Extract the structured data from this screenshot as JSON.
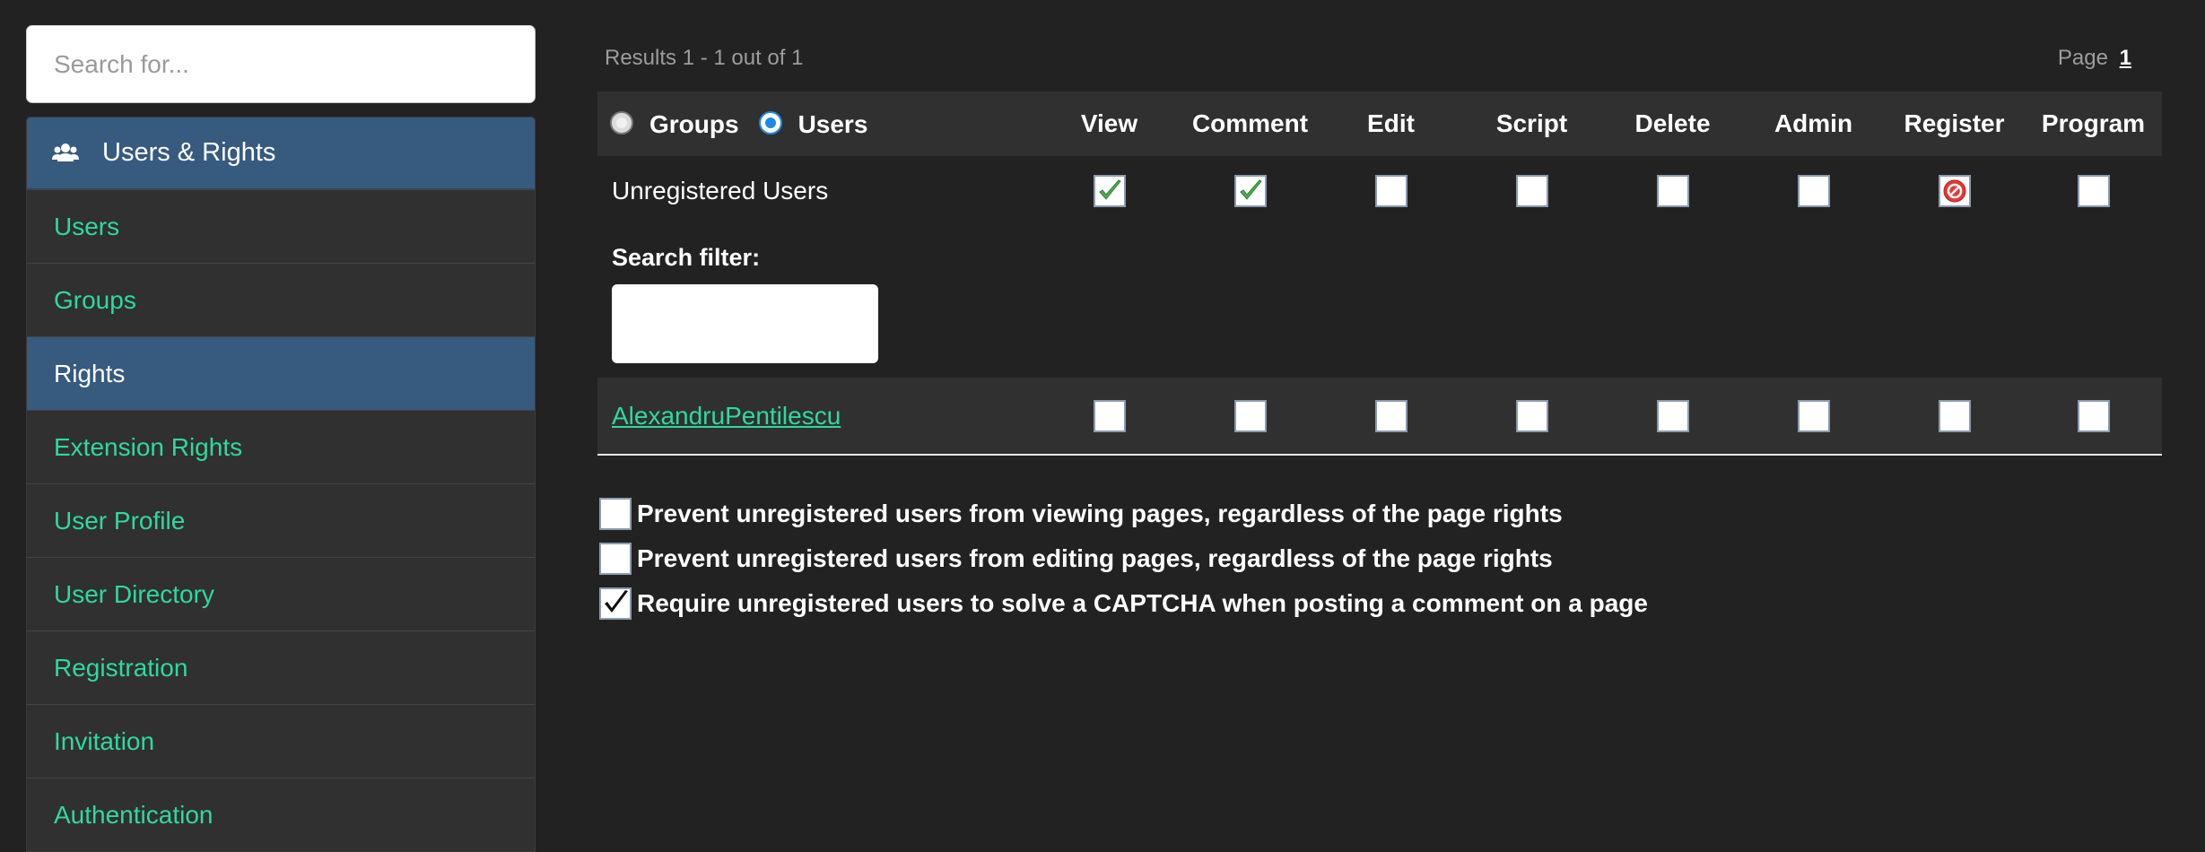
{
  "sidebar": {
    "search_placeholder": "Search for...",
    "heading": "Users & Rights",
    "heading_icon": "users-icon",
    "items": [
      {
        "label": "Users"
      },
      {
        "label": "Groups"
      },
      {
        "label": "Rights"
      },
      {
        "label": "Extension Rights"
      },
      {
        "label": "User Profile"
      },
      {
        "label": "User Directory"
      },
      {
        "label": "Registration"
      },
      {
        "label": "Invitation"
      },
      {
        "label": "Authentication"
      }
    ],
    "active_item": "Rights"
  },
  "results": {
    "summary": "Results 1 - 1 out of 1",
    "page_label": "Page",
    "page_number": "1"
  },
  "table": {
    "radio_groups": "Groups",
    "radio_users": "Users",
    "selected_radio": "Users",
    "columns": [
      "View",
      "Comment",
      "Edit",
      "Script",
      "Delete",
      "Admin",
      "Register",
      "Program"
    ],
    "unregistered_label": "Unregistered Users",
    "unregistered_states": [
      "allow",
      "allow",
      "none",
      "none",
      "none",
      "none",
      "deny",
      "none"
    ],
    "search_filter_label": "Search filter:",
    "users": [
      {
        "name": "AlexandruPentilescu",
        "states": [
          "none",
          "none",
          "none",
          "none",
          "none",
          "none",
          "none",
          "none"
        ]
      }
    ]
  },
  "options": [
    {
      "label": "Prevent unregistered users from viewing pages, regardless of the page rights",
      "checked": false
    },
    {
      "label": "Prevent unregistered users from editing pages, regardless of the page rights",
      "checked": false
    },
    {
      "label": "Require unregistered users to solve a CAPTCHA when posting a comment on a page",
      "checked": true
    }
  ],
  "colors": {
    "background": "#222222",
    "accent_blue": "#375a7f",
    "link_green": "#2fd99e",
    "allow_green": "#4caf50",
    "deny_red": "#e53935"
  }
}
